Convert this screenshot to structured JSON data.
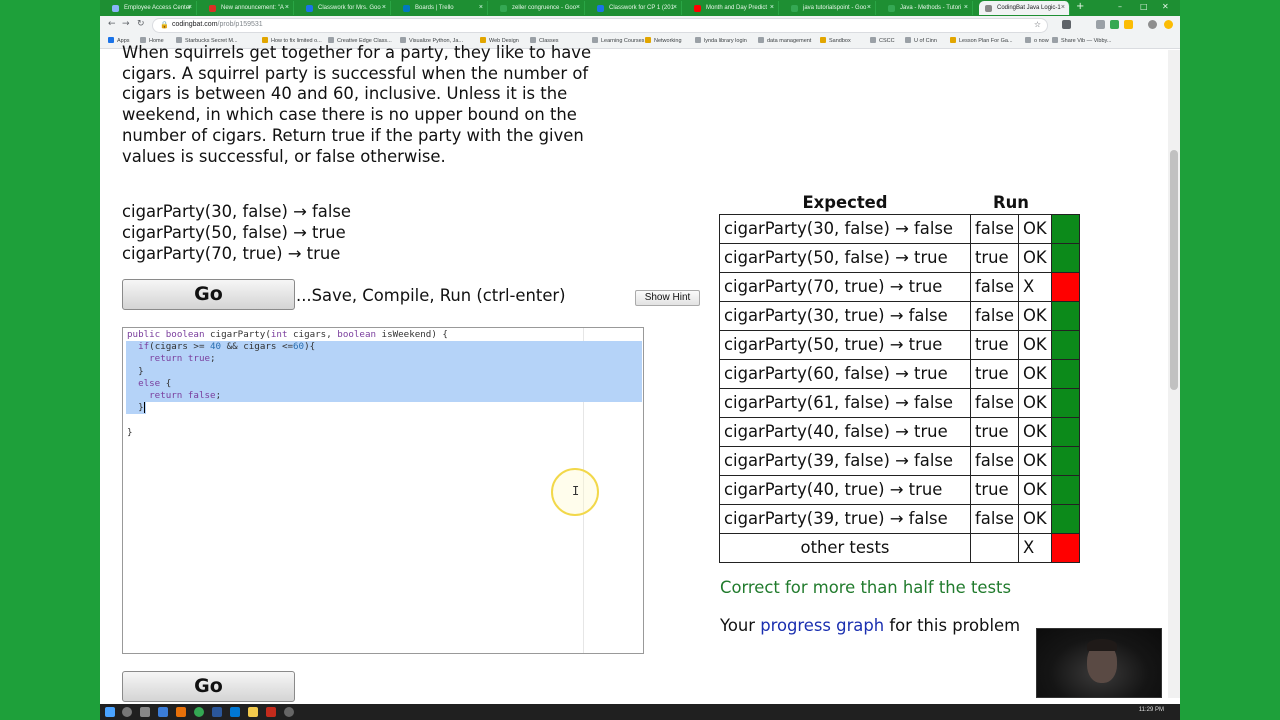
{
  "browser": {
    "tabs": [
      {
        "title": "Employee Access Center",
        "color": "#8ab4f8"
      },
      {
        "title": "New announcement: \"A",
        "color": "#d93025"
      },
      {
        "title": "Classwork for Mrs. Goo",
        "color": "#1a73e8"
      },
      {
        "title": "Boards | Trello",
        "color": "#0079bf"
      },
      {
        "title": "zeller congruence - Goo",
        "color": "#34a853"
      },
      {
        "title": "Classwork for CP 1 (201",
        "color": "#1a73e8"
      },
      {
        "title": "Month and Day Predict",
        "color": "#ff0000"
      },
      {
        "title": "java tutorialspoint - Goo",
        "color": "#34a853"
      },
      {
        "title": "Java - Methods - Tutori",
        "color": "#34a853"
      },
      {
        "title": "CodingBat Java Logic-1",
        "color": "#888888",
        "active": true
      }
    ],
    "new_tab": "+",
    "url_host": "codingbat.com",
    "url_path": "/prob/p159531",
    "bookmarks": [
      "Apps",
      "Home",
      "Starbucks Secret M...",
      "How to fix limited o...",
      "Creative Edge Class...",
      "Visualize Python, Ja...",
      "Web Design",
      "Classes",
      "Learning Courses",
      "Networking",
      "lynda library login",
      "data management",
      "Sandbox",
      "CSCC",
      "U of Cinn",
      "Lesson Plan For Ga...",
      "o now",
      "Share Vib — Vibby..."
    ]
  },
  "problem": {
    "text": "When squirrels get together for a party, they like to have cigars. A squirrel party is successful when the number of cigars is between 40 and 60, inclusive. Unless it is the weekend, in which case there is no upper bound on the number of cigars. Return true if the party with the given values is successful, or false otherwise.",
    "examples": [
      "cigarParty(30, false) → false",
      "cigarParty(50, false) → true",
      "cigarParty(70, true) → true"
    ]
  },
  "controls": {
    "go_label": "Go",
    "save_text": "...Save, Compile, Run (ctrl-enter)",
    "hint_label": "Show Hint"
  },
  "results": {
    "header_expected": "Expected",
    "header_run": "Run",
    "rows": [
      {
        "expected": "cigarParty(30, false) → false",
        "run": "false",
        "status": "OK",
        "pass": true
      },
      {
        "expected": "cigarParty(50, false) → true",
        "run": "true",
        "status": "OK",
        "pass": true
      },
      {
        "expected": "cigarParty(70, true) → true",
        "run": "false",
        "status": "X",
        "pass": false
      },
      {
        "expected": "cigarParty(30, true) → false",
        "run": "false",
        "status": "OK",
        "pass": true
      },
      {
        "expected": "cigarParty(50, true) → true",
        "run": "true",
        "status": "OK",
        "pass": true
      },
      {
        "expected": "cigarParty(60, false) → true",
        "run": "true",
        "status": "OK",
        "pass": true
      },
      {
        "expected": "cigarParty(61, false) → false",
        "run": "false",
        "status": "OK",
        "pass": true
      },
      {
        "expected": "cigarParty(40, false) → true",
        "run": "true",
        "status": "OK",
        "pass": true
      },
      {
        "expected": "cigarParty(39, false) → false",
        "run": "false",
        "status": "OK",
        "pass": true
      },
      {
        "expected": "cigarParty(40, true) → true",
        "run": "true",
        "status": "OK",
        "pass": true
      },
      {
        "expected": "cigarParty(39, true) → false",
        "run": "false",
        "status": "OK",
        "pass": true
      },
      {
        "expected": "other tests",
        "run": "",
        "status": "X",
        "pass": false
      }
    ],
    "summary": "Correct for more than half the tests",
    "progress_prefix": "Your ",
    "progress_link": "progress graph",
    "progress_suffix": " for this problem"
  },
  "taskbar": {
    "clock": "11:29 PM"
  },
  "colors": {
    "pass": "#0c8a1a",
    "fail": "#ff0000",
    "summary_text": "#217b2d",
    "link": "#1a2fb0",
    "selection": "#b5d3f8",
    "browser_frame": "#1e8f33"
  }
}
